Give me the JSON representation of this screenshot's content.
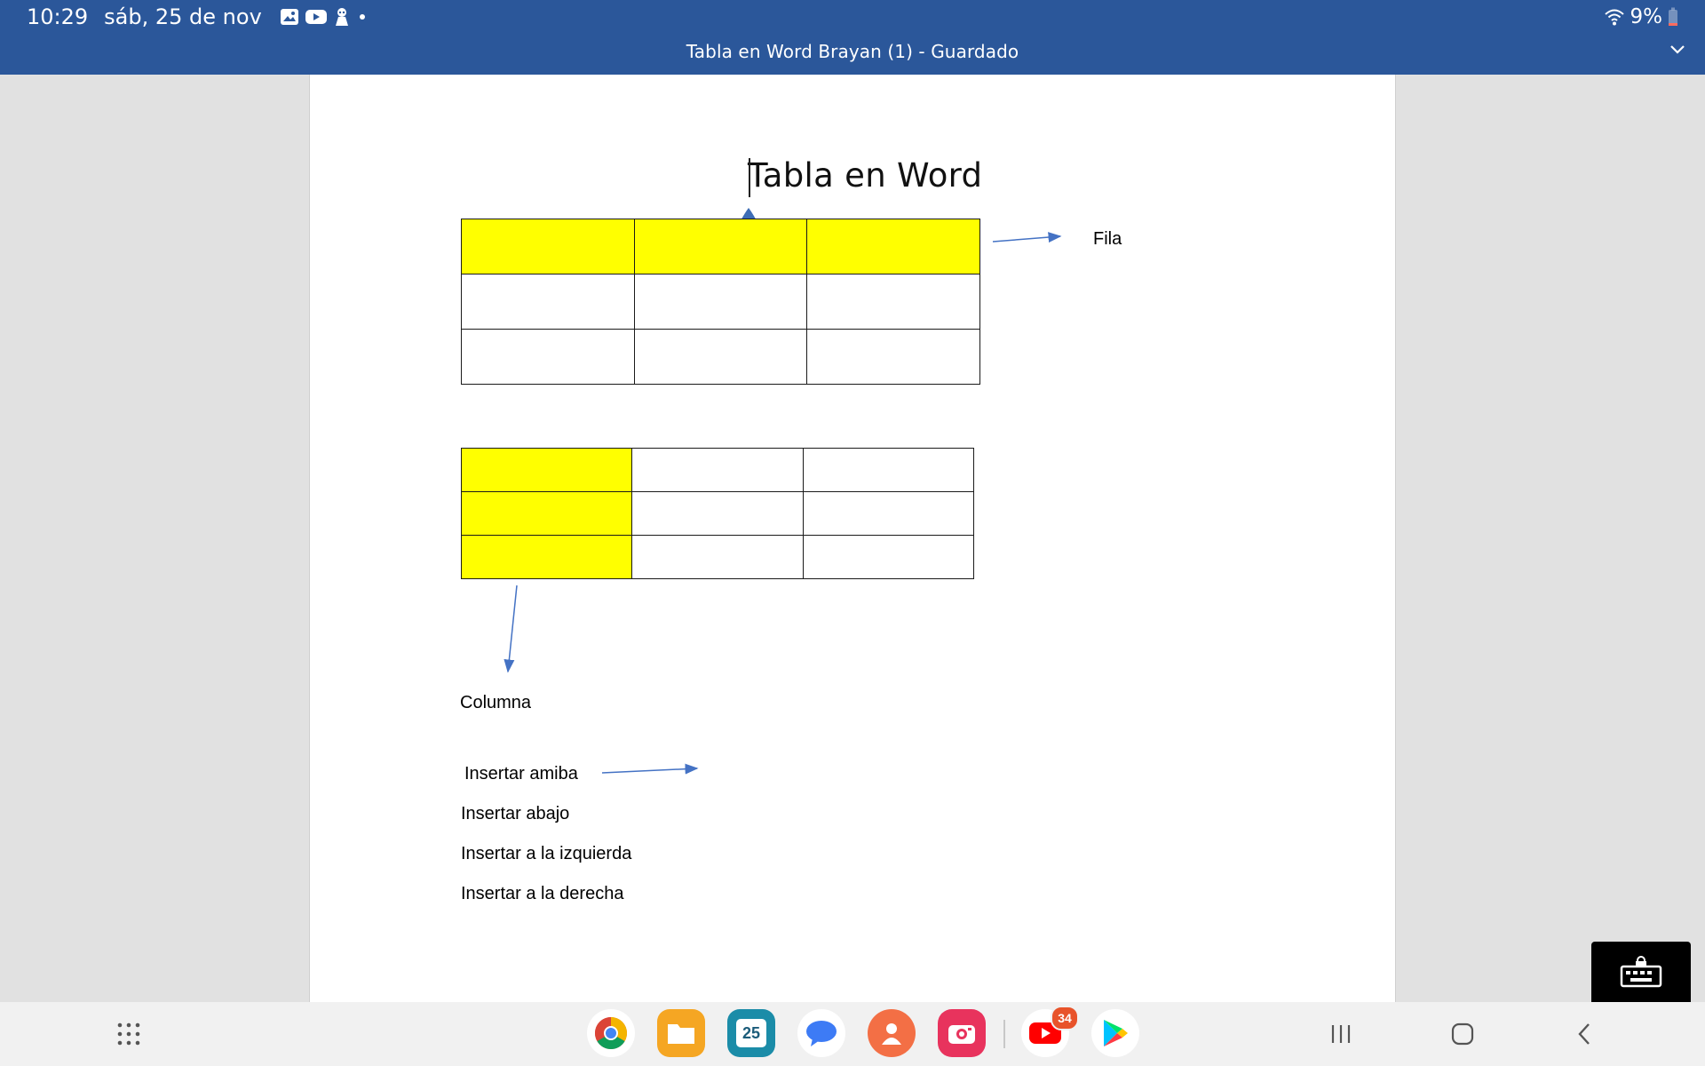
{
  "status_bar": {
    "time": "10:29",
    "date": "sáb, 25 de nov",
    "notification_icons": [
      "gallery-icon",
      "youtube-icon",
      "game-icon",
      "dot-icon"
    ],
    "wifi_icon": "wifi-icon",
    "battery": "9%"
  },
  "title_bar": {
    "document_title": "Tabla en Word Brayan (1) - Guardado",
    "chevron": "chevron-down-icon"
  },
  "document": {
    "heading": "Tabla en Word",
    "table_1": {
      "rows": 3,
      "cols": 3,
      "highlighted": "first-row",
      "highlight_color": "#ffff00"
    },
    "table_2": {
      "rows": 3,
      "cols": 3,
      "highlighted": "first-column",
      "highlight_color": "#ffff00"
    },
    "label_fila": "Fila",
    "label_columna": "Columna",
    "insert_items": [
      "Insertar amiba",
      "Insertar abajo",
      "Insertar a la izquierda",
      "Insertar a la derecha"
    ]
  },
  "taskbar": {
    "apps": [
      "apps-grid-icon",
      "chrome-icon",
      "files-icon",
      "calendar-icon",
      "messages-icon",
      "contacts-icon",
      "camera-icon",
      "youtube-icon",
      "play-store-icon"
    ],
    "calendar_day": "25",
    "youtube_badge": "34",
    "nav": [
      "recents-icon",
      "home-icon",
      "back-icon"
    ]
  },
  "colors": {
    "word_blue": "#2b579a",
    "highlight": "#ffff00",
    "arrow": "#4472c4"
  }
}
